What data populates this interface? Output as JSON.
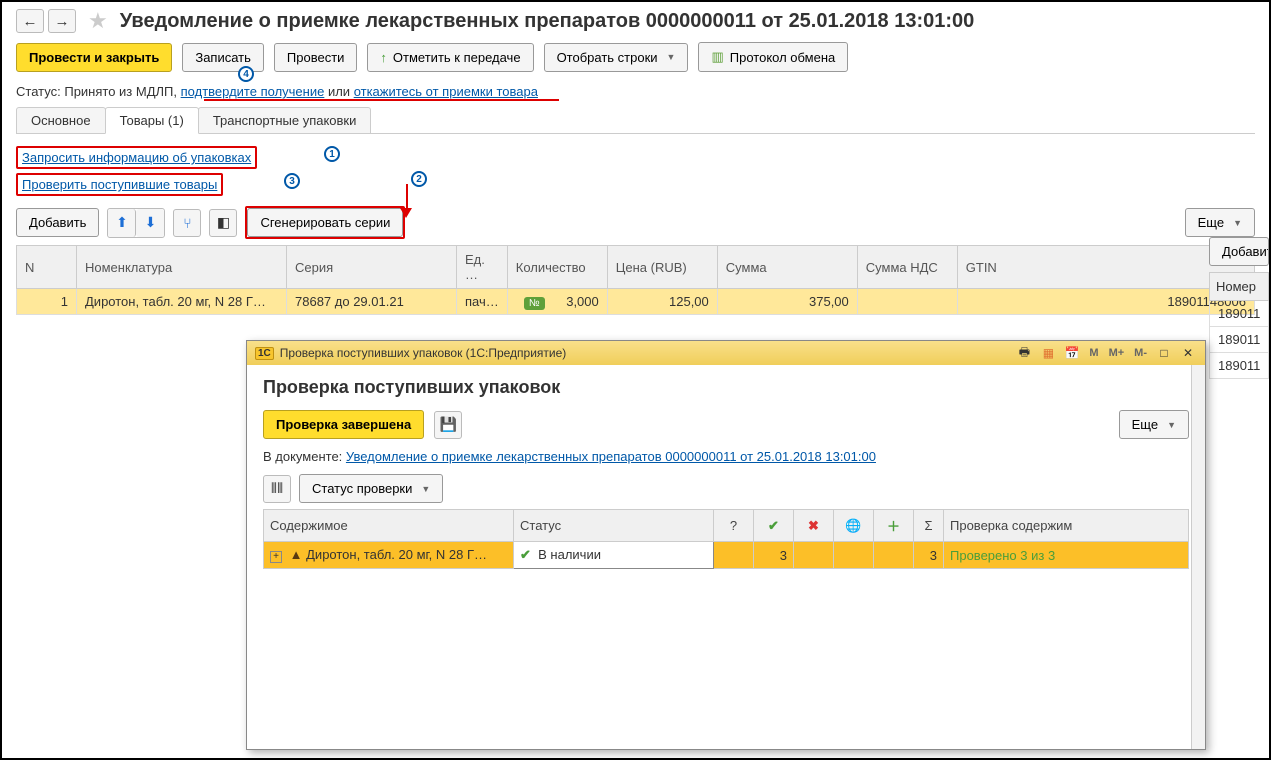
{
  "header": {
    "title": "Уведомление о приемке лекарственных препаратов 0000000011 от 25.01.2018 13:01:00"
  },
  "toolbar": {
    "post_close": "Провести и закрыть",
    "save": "Записать",
    "post": "Провести",
    "mark_transfer": "Отметить к передаче",
    "select_rows": "Отобрать строки",
    "exchange_protocol": "Протокол обмена"
  },
  "status": {
    "label": "Статус:",
    "value": "Принято из МДЛП,",
    "confirm_link": "подтвердите получение",
    "or": "или",
    "reject_link": "откажитесь от приемки товара"
  },
  "tabs": {
    "main": "Основное",
    "goods": "Товары (1)",
    "packages": "Транспортные упаковки"
  },
  "links": {
    "request_info": "Запросить информацию об упаковках",
    "check_goods": "Проверить поступившие товары"
  },
  "sub_toolbar": {
    "add": "Добавить",
    "gen_series": "Сгенерировать серии",
    "more": "Еще",
    "add2": "Добавить"
  },
  "grid": {
    "cols": {
      "n": "N",
      "nomenclature": "Номенклатура",
      "series": "Серия",
      "unit": "Ед. …",
      "qty": "Количество",
      "price": "Цена (RUB)",
      "sum": "Сумма",
      "vat": "Сумма НДС",
      "gtin": "GTIN"
    },
    "row": {
      "n": "1",
      "nomenclature": "Диротон, табл. 20 мг, N 28 Г…",
      "series": "78687 до 29.01.21",
      "unit": "пач…",
      "qty": "3,000",
      "price": "125,00",
      "sum": "375,00",
      "vat": "",
      "gtin": "18901148006"
    }
  },
  "side": {
    "header": "Номер",
    "r1": "189011",
    "r2": "189011",
    "r3": "189011"
  },
  "modal": {
    "window_title": "Проверка поступивших упаковок  (1С:Предприятие)",
    "title": "Проверка поступивших упаковок",
    "complete_btn": "Проверка завершена",
    "more": "Еще",
    "doc_label": "В документе:",
    "doc_link": "Уведомление о приемке лекарственных препаратов 0000000011 от 25.01.2018 13:01:00",
    "status_check": "Статус проверки",
    "grid": {
      "content": "Содержимое",
      "status": "Статус",
      "check_content": "Проверка содержим",
      "row_content": "Диротон, табл. 20 мг, N 28 Г…",
      "row_status": "В наличии",
      "row_check": "3",
      "row_sum": "3",
      "row_result": "Проверено 3 из 3"
    }
  },
  "callouts": {
    "c1": "1",
    "c2": "2",
    "c3": "3",
    "c4": "4"
  }
}
